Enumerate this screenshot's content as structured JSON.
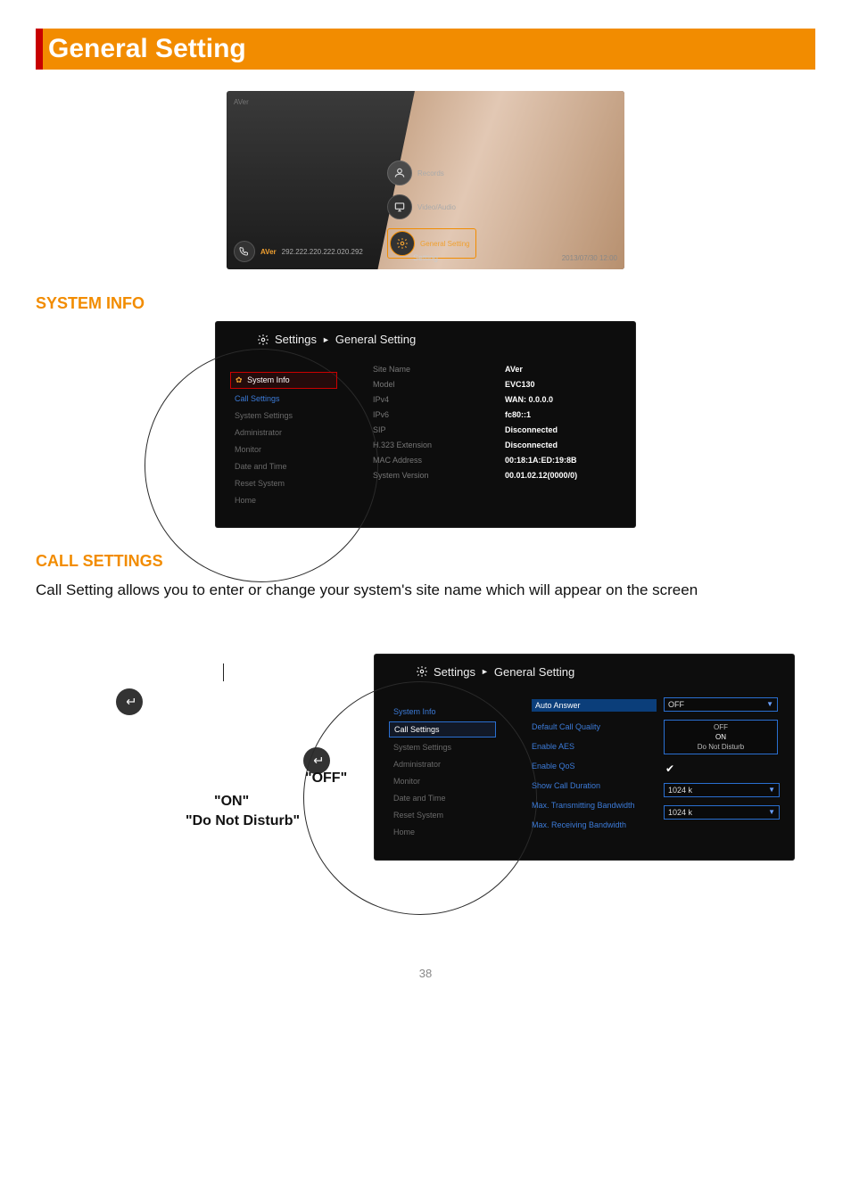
{
  "title": "General Setting",
  "hero": {
    "brand": "AVer",
    "records_label": "Records",
    "video_label": "Video/Audio",
    "general_label": "General Setting",
    "setting_label": "Setting",
    "ip": "292.222.220.222.020.292",
    "datetime": "2013/07/30  12:00"
  },
  "sections": {
    "system_info": "SYSTEM INFO",
    "call_settings": "CALL SETTINGS"
  },
  "screen1": {
    "breadcrumb_a": "Settings",
    "breadcrumb_sep": "►",
    "breadcrumb_b": "General Setting",
    "menu": {
      "system_info": "System Info",
      "call_settings": "Call Settings",
      "system_settings": "System Settings",
      "administrator": "Administrator",
      "monitor": "Monitor",
      "date_and_time": "Date and Time",
      "reset_system": "Reset System",
      "home": "Home"
    },
    "labels": {
      "site_name": "Site Name",
      "model": "Model",
      "ipv4": "IPv4",
      "ipv6": "IPv6",
      "sip": "SIP",
      "h323": "H.323 Extension",
      "mac": "MAC Address",
      "version": "System Version"
    },
    "values": {
      "site_name": "AVer",
      "model": "EVC130",
      "ipv4": "WAN: 0.0.0.0",
      "ipv6": "fc80::1",
      "sip": "Disconnected",
      "h323": "Disconnected",
      "mac": "00:18:1A:ED:19:8B",
      "version": "00.01.02.12(0000/0)"
    }
  },
  "body_text": "Call Setting allows you to enter or change your system's site name which will appear on the screen",
  "left_col": {
    "off": "\"OFF\"",
    "on": "\"ON\"",
    "dnd": "\"Do Not Disturb\""
  },
  "screen2": {
    "breadcrumb_a": "Settings",
    "breadcrumb_sep": "►",
    "breadcrumb_b": "General Setting",
    "menu": {
      "system_info": "System Info",
      "call_settings": "Call Settings",
      "system_settings": "System Settings",
      "administrator": "Administrator",
      "monitor": "Monitor",
      "date_and_time": "Date and Time",
      "reset_system": "Reset System",
      "home": "Home"
    },
    "labels": {
      "auto_answer": "Auto Answer",
      "default_quality": "Default Call Quality",
      "enable_aes": "Enable AES",
      "enable_qos": "Enable QoS",
      "show_duration": "Show Call Duration",
      "max_tx": "Max. Transmitting Bandwidth",
      "max_rx": "Max. Receiving Bandwidth"
    },
    "values": {
      "auto_answer": "OFF",
      "panel_off": "OFF",
      "panel_on": "ON",
      "panel_dnd": "Do Not Disturb",
      "max_tx": "1024 k",
      "max_rx": "1024 k"
    }
  },
  "page_number": "38"
}
